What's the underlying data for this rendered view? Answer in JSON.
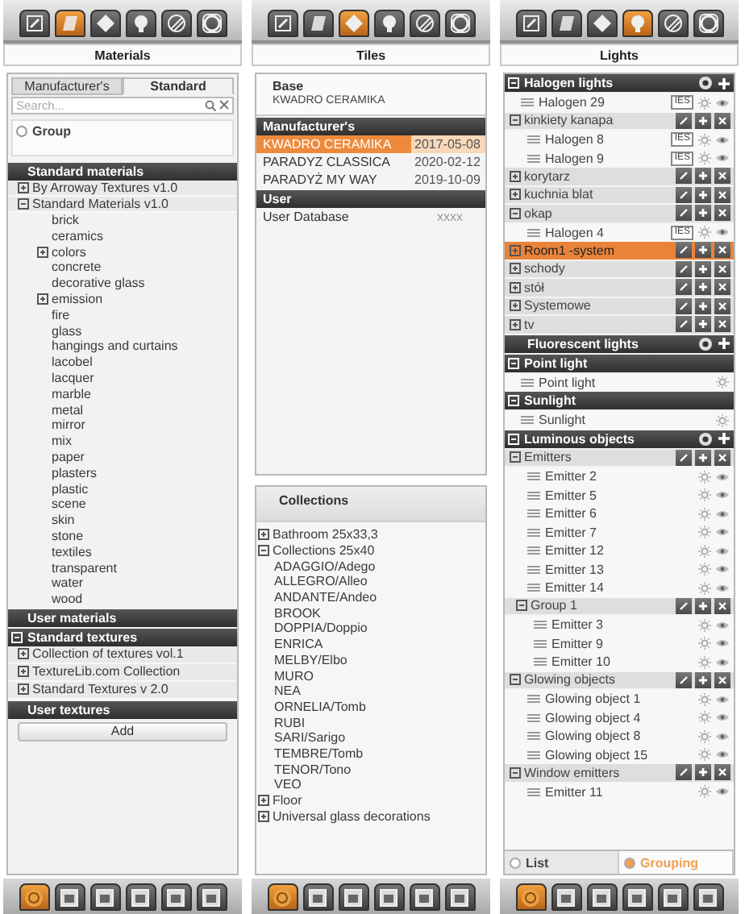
{
  "materials": {
    "toolbar": [
      {
        "selected": false
      },
      {
        "selected": true
      },
      {
        "selected": false
      },
      {
        "selected": false
      },
      {
        "selected": false
      },
      {
        "selected": false
      }
    ],
    "title": "Materials",
    "tabs": [
      {
        "label": "Manufacturer's",
        "selected": false
      },
      {
        "label": "Standard",
        "selected": true
      }
    ],
    "search": {
      "placeholder": "Search..."
    },
    "group_option": {
      "label": "Group",
      "selected": false
    },
    "sections": [
      {
        "title": "Standard materials",
        "items": [
          {
            "label": "By Arroway Textures v1.0",
            "expanded": false
          },
          {
            "label": "Standard Materials v1.0",
            "expanded": true,
            "children": [
              {
                "label": "brick"
              },
              {
                "label": "ceramics"
              },
              {
                "label": "colors",
                "expanded": false
              },
              {
                "label": "concrete"
              },
              {
                "label": "decorative glass"
              },
              {
                "label": "emission",
                "expanded": false
              },
              {
                "label": "fire"
              },
              {
                "label": "glass"
              },
              {
                "label": "hangings and curtains"
              },
              {
                "label": "lacobel"
              },
              {
                "label": "lacquer"
              },
              {
                "label": "marble"
              },
              {
                "label": "metal"
              },
              {
                "label": "mirror"
              },
              {
                "label": "mix"
              },
              {
                "label": "paper"
              },
              {
                "label": "plasters"
              },
              {
                "label": "plastic"
              },
              {
                "label": "scene"
              },
              {
                "label": "skin"
              },
              {
                "label": "stone"
              },
              {
                "label": "textiles"
              },
              {
                "label": "transparent"
              },
              {
                "label": "water"
              },
              {
                "label": "wood"
              }
            ]
          }
        ]
      },
      {
        "title": "User materials"
      },
      {
        "title": "Standard textures",
        "expanded": true,
        "items": [
          {
            "label": "Collection of textures vol.1",
            "expanded": false
          },
          {
            "label": "TextureLib.com Collection",
            "expanded": false
          },
          {
            "label": "Standard Textures v 2.0",
            "expanded": false
          }
        ]
      },
      {
        "title": "User textures"
      }
    ],
    "add_button": "Add",
    "bottom_toolbar": [
      {
        "selected": true
      },
      {
        "selected": false
      },
      {
        "selected": false
      },
      {
        "selected": false
      },
      {
        "selected": false
      },
      {
        "selected": false
      }
    ]
  },
  "tiles": {
    "toolbar": [
      {
        "selected": false
      },
      {
        "selected": false
      },
      {
        "selected": true
      },
      {
        "selected": false
      },
      {
        "selected": false
      },
      {
        "selected": false
      }
    ],
    "title": "Tiles",
    "base": {
      "label": "Base",
      "value": "KWADRO CERAMIKA"
    },
    "sections": [
      {
        "title": "Manufacturer's",
        "rows": [
          {
            "name": "KWADRO CERAMIKA",
            "date": "2017-05-08",
            "selected": true
          },
          {
            "name": "PARADYZ CLASSICA",
            "date": "2020-02-12",
            "selected": false
          },
          {
            "name": "PARADYŻ MY WAY",
            "date": "2019-10-09",
            "selected": false
          }
        ]
      },
      {
        "title": "User",
        "rows": [
          {
            "name": "User Database",
            "date": "xxxx",
            "selected": false
          }
        ]
      }
    ],
    "collections": {
      "title": "Collections",
      "items": [
        {
          "label": "Bathroom 25x33,3",
          "expanded": false
        },
        {
          "label": "Collections 25x40",
          "expanded": true,
          "children": [
            {
              "label": "ADAGGIO/Adego"
            },
            {
              "label": "ALLEGRO/Alleo"
            },
            {
              "label": "ANDANTE/Andeo"
            },
            {
              "label": "BROOK"
            },
            {
              "label": "DOPPIA/Doppio"
            },
            {
              "label": "ENRICA"
            },
            {
              "label": "MELBY/Elbo"
            },
            {
              "label": "MURO"
            },
            {
              "label": "NEA"
            },
            {
              "label": "ORNELIA/Tomb"
            },
            {
              "label": "RUBI"
            },
            {
              "label": "SARI/Sarigo"
            },
            {
              "label": "TEMBRE/Tomb"
            },
            {
              "label": "TENOR/Tono"
            },
            {
              "label": "VEO"
            }
          ]
        },
        {
          "label": "Floor",
          "expanded": false
        },
        {
          "label": "Universal glass decorations",
          "expanded": false
        }
      ]
    },
    "bottom_toolbar": [
      {
        "selected": true
      },
      {
        "selected": false
      },
      {
        "selected": false
      },
      {
        "selected": false
      },
      {
        "selected": false
      },
      {
        "selected": false
      }
    ]
  },
  "lights": {
    "toolbar": [
      {
        "selected": false
      },
      {
        "selected": false
      },
      {
        "selected": false
      },
      {
        "selected": true
      },
      {
        "selected": false
      },
      {
        "selected": false
      }
    ],
    "title": "Lights",
    "groups": [
      {
        "title": "Halogen lights",
        "expanded": true,
        "tools": true,
        "items": [
          {
            "kind": "lamp",
            "label": "Halogen 29",
            "badge": "IES"
          },
          {
            "kind": "group",
            "label": "kinkiety kanapa",
            "expanded": true,
            "selected": false,
            "children": [
              {
                "kind": "lamp",
                "label": "Halogen 8",
                "badge": "IES"
              },
              {
                "kind": "lamp",
                "label": "Halogen 9",
                "badge": "IES"
              }
            ]
          },
          {
            "kind": "group",
            "label": "korytarz",
            "expanded": false,
            "selected": false
          },
          {
            "kind": "group",
            "label": "kuchnia blat",
            "expanded": false,
            "selected": false
          },
          {
            "kind": "group",
            "label": "okap",
            "expanded": true,
            "selected": false,
            "children": [
              {
                "kind": "lamp",
                "label": "Halogen 4",
                "badge": "IES"
              }
            ]
          },
          {
            "kind": "group",
            "label": "Room1 -system",
            "expanded": false,
            "selected": true
          },
          {
            "kind": "group",
            "label": "schody",
            "expanded": false,
            "selected": false
          },
          {
            "kind": "group",
            "label": "stół",
            "expanded": false,
            "selected": false
          },
          {
            "kind": "group",
            "label": "Systemowe",
            "expanded": false,
            "selected": false
          },
          {
            "kind": "group",
            "label": "tv",
            "expanded": false,
            "selected": false
          }
        ]
      },
      {
        "title": "Fluorescent lights",
        "tools": true
      },
      {
        "title": "Point light",
        "expanded": true,
        "tools": false,
        "items": [
          {
            "kind": "sun",
            "label": "Point light"
          }
        ]
      },
      {
        "title": "Sunlight",
        "expanded": true,
        "tools": false,
        "items": [
          {
            "kind": "sun",
            "label": "Sunlight"
          }
        ]
      },
      {
        "title": "Luminous objects",
        "expanded": true,
        "tools": true,
        "items": [
          {
            "kind": "group",
            "label": "Emitters",
            "expanded": true,
            "selected": false,
            "children": [
              {
                "kind": "lamp",
                "label": "Emitter 2"
              },
              {
                "kind": "lamp",
                "label": "Emitter 5"
              },
              {
                "kind": "lamp",
                "label": "Emitter 6"
              },
              {
                "kind": "lamp",
                "label": "Emitter 7"
              },
              {
                "kind": "lamp",
                "label": "Emitter 12"
              },
              {
                "kind": "lamp",
                "label": "Emitter 13"
              },
              {
                "kind": "lamp",
                "label": "Emitter 14"
              },
              {
                "kind": "group",
                "label": "Group 1",
                "expanded": true,
                "selected": false,
                "children": [
                  {
                    "kind": "lamp",
                    "label": "Emitter 3"
                  },
                  {
                    "kind": "lamp",
                    "label": "Emitter 9"
                  },
                  {
                    "kind": "lamp",
                    "label": "Emitter 10"
                  }
                ]
              }
            ]
          },
          {
            "kind": "group",
            "label": "Glowing objects",
            "expanded": true,
            "selected": false,
            "children": [
              {
                "kind": "lamp",
                "label": "Glowing object 1"
              },
              {
                "kind": "lamp",
                "label": "Glowing object 4"
              },
              {
                "kind": "lamp",
                "label": "Glowing object 8"
              },
              {
                "kind": "lamp",
                "label": "Glowing object 15"
              }
            ]
          },
          {
            "kind": "group",
            "label": "Window emitters",
            "expanded": true,
            "selected": false,
            "children": [
              {
                "kind": "lamp",
                "label": "Emitter 11"
              }
            ]
          }
        ]
      }
    ],
    "view_tabs": [
      {
        "label": "List",
        "selected": false
      },
      {
        "label": "Grouping",
        "selected": true
      }
    ],
    "bottom_toolbar": [
      {
        "selected": true
      },
      {
        "selected": false
      },
      {
        "selected": false
      },
      {
        "selected": false
      },
      {
        "selected": false
      },
      {
        "selected": false
      }
    ]
  }
}
